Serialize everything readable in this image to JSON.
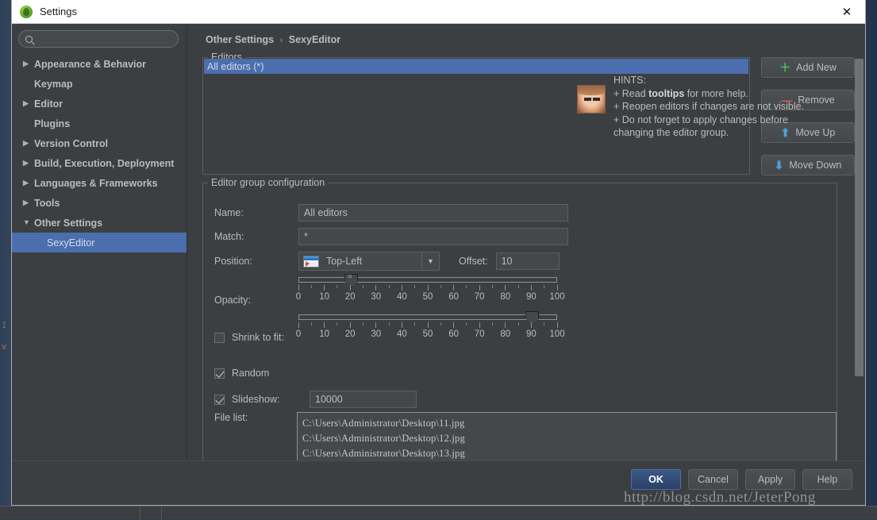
{
  "window": {
    "title": "Settings",
    "app_icon": "android-studio-icon",
    "close_icon": "close-icon"
  },
  "sidebar": {
    "search": {
      "value": "",
      "placeholder": "",
      "icon": "search-icon"
    },
    "items": [
      {
        "label": "Appearance & Behavior",
        "arrow": "▶",
        "selected": false,
        "child": false
      },
      {
        "label": "Keymap",
        "arrow": "",
        "selected": false,
        "child": false
      },
      {
        "label": "Editor",
        "arrow": "▶",
        "selected": false,
        "child": false
      },
      {
        "label": "Plugins",
        "arrow": "",
        "selected": false,
        "child": false
      },
      {
        "label": "Version Control",
        "arrow": "▶",
        "selected": false,
        "child": false
      },
      {
        "label": "Build, Execution, Deployment",
        "arrow": "▶",
        "selected": false,
        "child": false
      },
      {
        "label": "Languages & Frameworks",
        "arrow": "▶",
        "selected": false,
        "child": false
      },
      {
        "label": "Tools",
        "arrow": "▶",
        "selected": false,
        "child": false
      },
      {
        "label": "Other Settings",
        "arrow": "▼",
        "selected": false,
        "child": false
      },
      {
        "label": "SexyEditor",
        "arrow": "",
        "selected": true,
        "child": true
      }
    ]
  },
  "breadcrumb": {
    "root": "Other Settings",
    "separator": "›",
    "leaf": "SexyEditor"
  },
  "editors_group": {
    "legend": "Editors",
    "rows": [
      {
        "label": "All editors (*)",
        "selected": true
      }
    ]
  },
  "side_buttons": [
    {
      "label": "Add New",
      "glyph": "＋",
      "color": "#4ac14a",
      "name": "add-new-button"
    },
    {
      "label": "Remove",
      "glyph": "—",
      "color": "#e05c4b",
      "name": "remove-button"
    },
    {
      "label": "Move Up",
      "glyph": "⬆",
      "color": "#4aa3df",
      "name": "move-up-button"
    },
    {
      "label": "Move Down",
      "glyph": "⬇",
      "color": "#4aa3df",
      "name": "move-down-button"
    }
  ],
  "config_group": {
    "legend": "Editor group configuration",
    "name": {
      "label": "Name:",
      "value": "All editors"
    },
    "match": {
      "label": "Match:",
      "value": "*"
    },
    "position": {
      "label": "Position:",
      "value": "Top-Left",
      "icon": "window-position-icon",
      "arrow_icon": "chevron-down-icon"
    },
    "offset": {
      "label": "Offset:",
      "value": "10"
    },
    "opacity": {
      "label": "Opacity:",
      "value": 20,
      "min": 0,
      "max": 100,
      "tick_labels": [
        "0",
        "10",
        "20",
        "30",
        "40",
        "50",
        "60",
        "70",
        "80",
        "90",
        "100"
      ]
    },
    "shrink_to_fit": {
      "label": "Shrink to fit:",
      "checked": false,
      "value": 90,
      "min": 0,
      "max": 100,
      "tick_labels": [
        "0",
        "10",
        "20",
        "30",
        "40",
        "50",
        "60",
        "70",
        "80",
        "90",
        "100"
      ]
    },
    "random": {
      "label": "Random",
      "checked": true
    },
    "slideshow": {
      "label": "Slideshow:",
      "checked": true,
      "value": "10000"
    },
    "file_list": {
      "label": "File list:",
      "lines": [
        "C:\\Users\\Administrator\\Desktop\\11.jpg",
        "C:\\Users\\Administrator\\Desktop\\12.jpg",
        "C:\\Users\\Administrator\\Desktop\\13.jpg"
      ]
    }
  },
  "hints": {
    "avatar": "girl-avatar-icon",
    "title": "HINTS:",
    "line1_pre": "+ Read ",
    "line1_bold": "tooltips",
    "line1_post": " for more help.",
    "line2": "+ Reopen editors if changes are not visible.",
    "line3": "+ Do not forget to apply changes before",
    "line4": "changing the editor group."
  },
  "dialog_buttons": [
    {
      "label": "OK",
      "primary": true,
      "name": "ok-button"
    },
    {
      "label": "Cancel",
      "primary": false,
      "name": "cancel-button"
    },
    {
      "label": "Apply",
      "primary": false,
      "name": "apply-button"
    },
    {
      "label": "Help",
      "primary": false,
      "name": "help-button"
    }
  ],
  "watermark": "http://blog.csdn.net/JeterPong"
}
